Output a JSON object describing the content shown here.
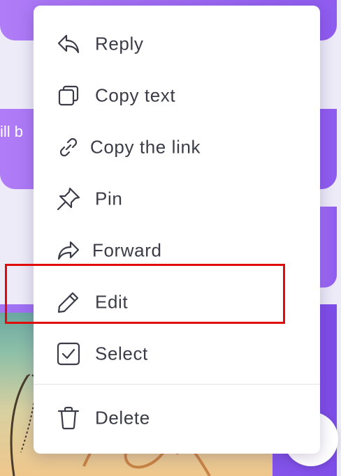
{
  "background": {
    "partial_message_text": "ill b",
    "accent_gradient": [
      "#b07cf7",
      "#8f5cf0"
    ]
  },
  "menu": {
    "items": [
      {
        "id": "reply",
        "label": "Reply",
        "icon": "reply-icon"
      },
      {
        "id": "copy-text",
        "label": "Copy text",
        "icon": "copy-icon"
      },
      {
        "id": "copy-link",
        "label": "Copy the link",
        "icon": "link-icon"
      },
      {
        "id": "pin",
        "label": "Pin",
        "icon": "pin-icon"
      },
      {
        "id": "forward",
        "label": "Forward",
        "icon": "forward-icon"
      },
      {
        "id": "edit",
        "label": "Edit",
        "icon": "pencil-icon",
        "highlighted": true
      },
      {
        "id": "select",
        "label": "Select",
        "icon": "checkbox-icon"
      },
      {
        "id": "delete",
        "label": "Delete",
        "icon": "trash-icon"
      }
    ],
    "highlight_color": "#e00b0b",
    "text_color": "#3c3c48"
  }
}
